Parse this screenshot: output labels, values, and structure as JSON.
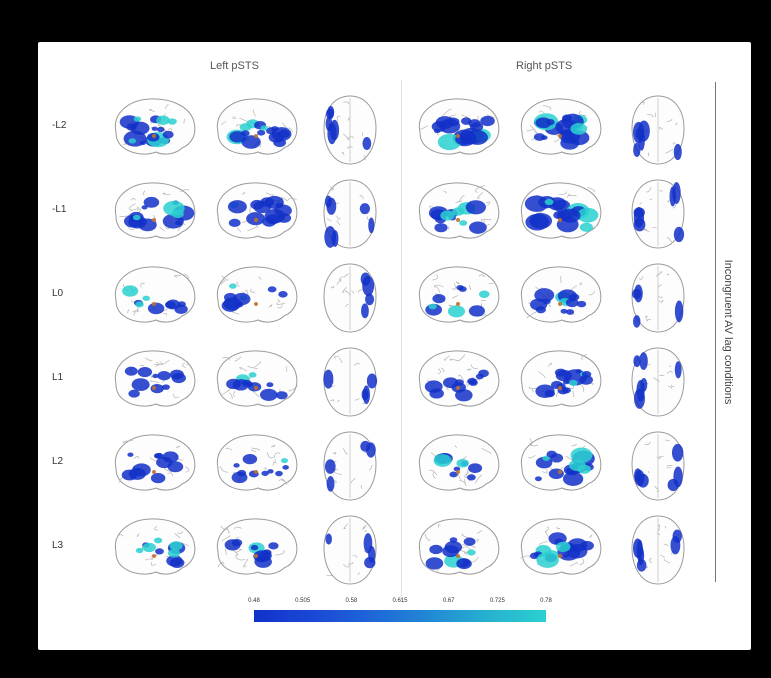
{
  "columns": {
    "left": "Left pSTS",
    "right": "Right pSTS"
  },
  "rows": [
    "-L2",
    "-L1",
    "L0",
    "L1",
    "L2",
    "L3"
  ],
  "side_label": "Incongruent AV lag conditions",
  "colorbar": {
    "ticks": [
      "0.48",
      "0.505",
      "0.58",
      "0.615",
      "0.67",
      "0.725",
      "0.78"
    ],
    "colors": [
      "#1230c8",
      "#2ad0d0"
    ]
  },
  "activation_levels": [
    [
      0.9,
      0.8,
      0.5,
      0.85,
      0.9,
      0.45
    ],
    [
      0.7,
      0.7,
      0.45,
      0.55,
      0.85,
      0.45
    ],
    [
      0.35,
      0.35,
      0.2,
      0.3,
      0.55,
      0.3
    ],
    [
      0.45,
      0.4,
      0.3,
      0.45,
      0.8,
      0.45
    ],
    [
      0.45,
      0.4,
      0.3,
      0.45,
      0.75,
      0.45
    ],
    [
      0.45,
      0.45,
      0.3,
      0.45,
      0.75,
      0.45
    ]
  ],
  "colors": {
    "activation_low": "#1230c8",
    "activation_high": "#2ad0d0",
    "peak": "#c07030",
    "brain_outline": "#9a9a9a"
  }
}
